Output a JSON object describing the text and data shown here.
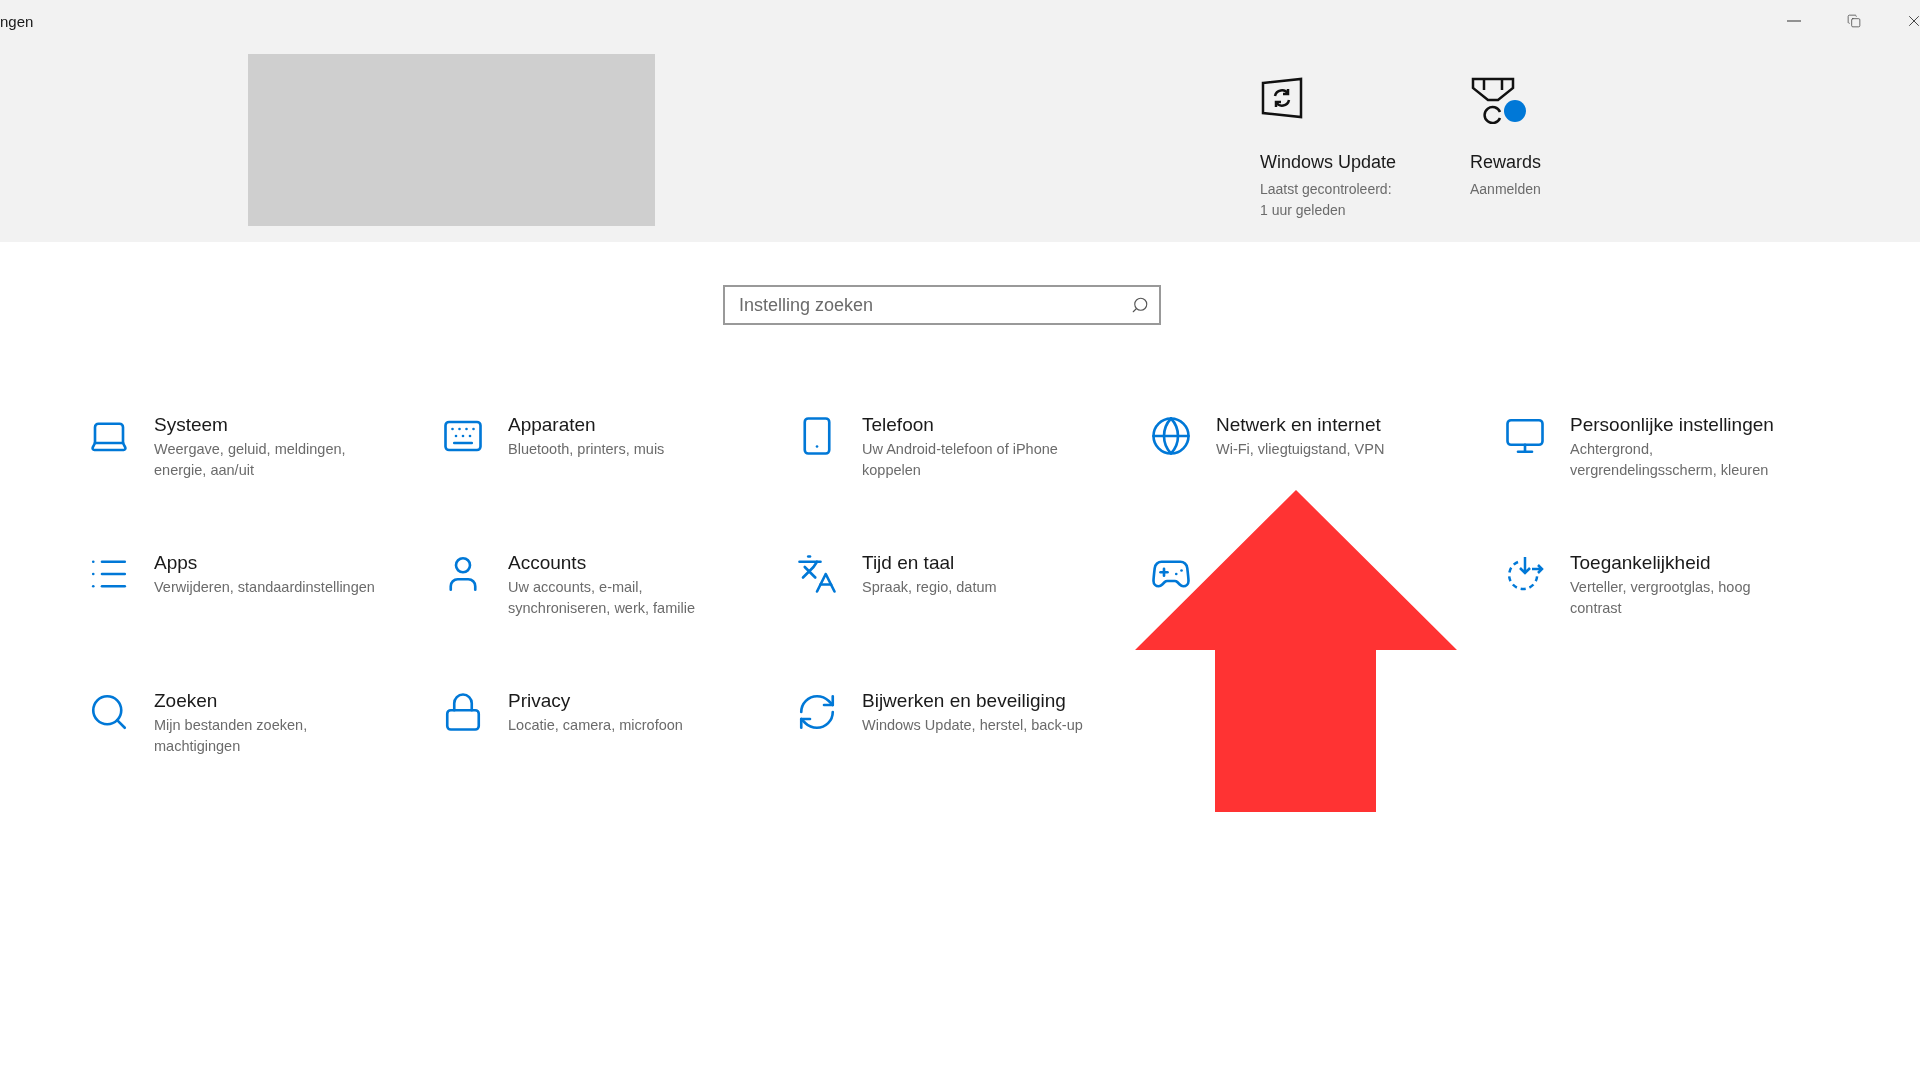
{
  "window": {
    "title": "ngen"
  },
  "header": {
    "quick_links": [
      {
        "title": "Windows Update",
        "subtitle": "Laatst gecontroleerd:\n1 uur geleden",
        "badge": false
      },
      {
        "title": "Rewards",
        "subtitle": "Aanmelden",
        "badge": true
      }
    ]
  },
  "search": {
    "placeholder": "Instelling zoeken"
  },
  "categories": [
    {
      "kind": "setting",
      "title": "Systeem",
      "subtitle": "Weergave, geluid, meldingen, energie, aan/uit"
    },
    {
      "kind": "setting",
      "title": "Apparaten",
      "subtitle": "Bluetooth, printers, muis"
    },
    {
      "kind": "setting",
      "title": "Telefoon",
      "subtitle": "Uw Android-telefoon of iPhone koppelen"
    },
    {
      "kind": "setting",
      "title": "Netwerk en internet",
      "subtitle": "Wi-Fi, vliegtuigstand, VPN"
    },
    {
      "kind": "setting",
      "title": "Persoonlijke instellingen",
      "subtitle": "Achtergrond, vergrendelingsscherm, kleuren"
    },
    {
      "kind": "setting",
      "title": "Apps",
      "subtitle": "Verwijderen, standaardinstellingen"
    },
    {
      "kind": "setting",
      "title": "Accounts",
      "subtitle": "Uw accounts, e-mail, synchroniseren, werk, familie"
    },
    {
      "kind": "setting",
      "title": "Tijd en taal",
      "subtitle": "Spraak, regio, datum"
    },
    {
      "kind": "obscured"
    },
    {
      "kind": "setting",
      "title": "Toegankelijkheid",
      "subtitle": "Verteller, vergrootglas, hoog contrast"
    },
    {
      "kind": "setting",
      "title": "Zoeken",
      "subtitle": "Mijn bestanden zoeken, machtigingen"
    },
    {
      "kind": "setting",
      "title": "Privacy",
      "subtitle": "Locatie, camera, microfoon"
    },
    {
      "kind": "setting",
      "title": "Bijwerken en beveiliging",
      "subtitle": "Windows Update, herstel, back-up"
    }
  ],
  "annotation": {
    "kind": "arrow"
  }
}
